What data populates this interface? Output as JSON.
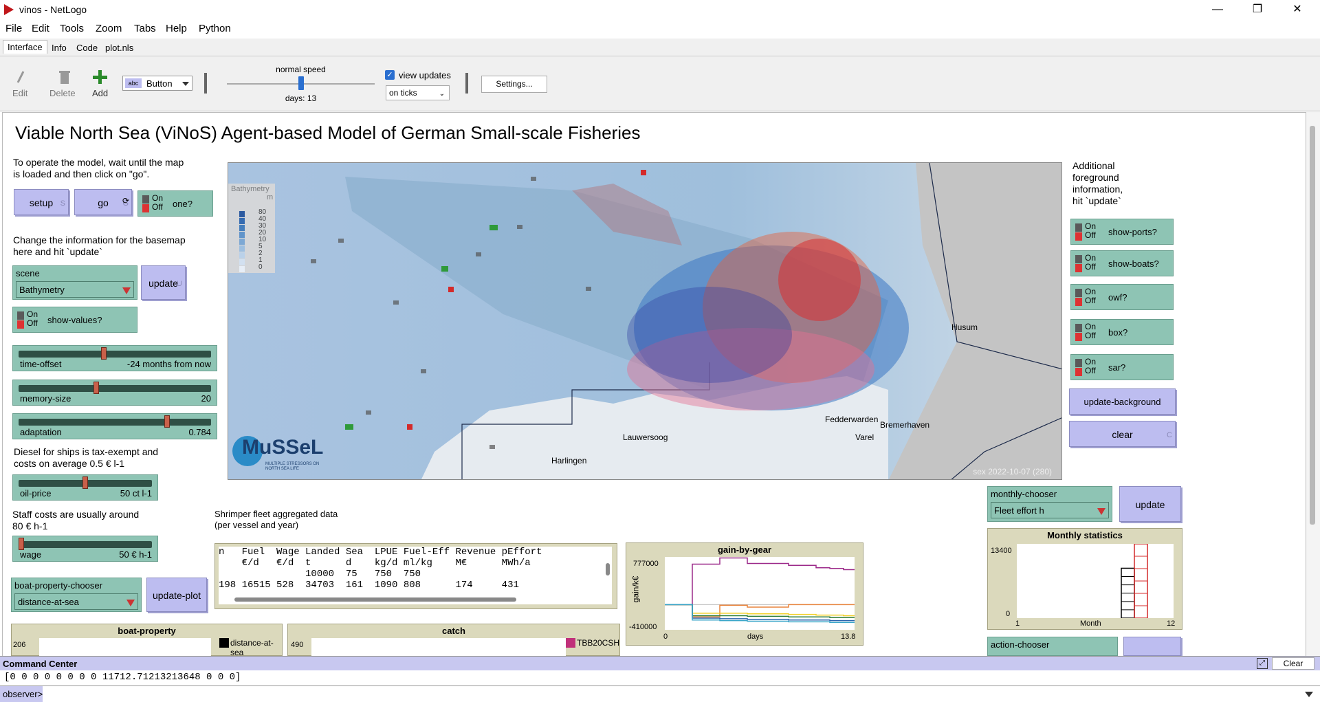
{
  "window": {
    "title": "vinos - NetLogo",
    "min_glyph": "—",
    "max_glyph": "❐",
    "close_glyph": "✕"
  },
  "menu": [
    "File",
    "Edit",
    "Tools",
    "Zoom",
    "Tabs",
    "Help",
    "Python"
  ],
  "tabs": [
    "Interface",
    "Info",
    "Code",
    "plot.nls"
  ],
  "toolbar": {
    "edit": "Edit",
    "delete": "Delete",
    "add": "Add",
    "widget_type": "Button",
    "speed_label": "normal speed",
    "ticks_label": "days: 13",
    "speed_fraction": 0.5,
    "view_updates": "view updates",
    "update_mode": "on ticks",
    "settings": "Settings..."
  },
  "model": {
    "title": "Viable North Sea (ViNoS) Agent-based Model of German Small-scale Fisheries",
    "intro": [
      "To operate the model, wait until the map",
      "is loaded and then click on \"go\"."
    ],
    "basemap_note": [
      "Change the information for the basemap",
      "here and hit `update`"
    ],
    "diesel_note": [
      "Diesel for ships is tax-exempt and",
      "costs on average 0.5 € l-1"
    ],
    "staff_note": [
      "Staff costs are usually around",
      "80 € h-1"
    ],
    "foreground_note": [
      "Additional",
      "foreground",
      "information,",
      "hit `update`"
    ],
    "fleet_note": [
      "Shrimper fleet aggregated data",
      "(per vessel and year)"
    ]
  },
  "buttons": {
    "setup": "setup",
    "setup_key": "S",
    "go": "go",
    "go_key": "G",
    "update_scene": "update",
    "update_scene_key": "U",
    "update_plot": "update-plot",
    "update_background": "update-background",
    "clear": "clear",
    "clear_key": "C",
    "update_monthly": "update"
  },
  "switches": {
    "on": "On",
    "off": "Off",
    "one": "one?",
    "show_values": "show-values?",
    "show_ports": "show-ports?",
    "show_boats": "show-boats?",
    "owf": "owf?",
    "box": "box?",
    "sar": "sar?"
  },
  "sliders": [
    {
      "label": "time-offset",
      "value": "-24 months from now",
      "fraction": 0.44
    },
    {
      "label": "memory-size",
      "value": "20",
      "fraction": 0.4
    },
    {
      "label": "adaptation",
      "value": "0.784",
      "fraction": 0.78
    },
    {
      "label": "oil-price",
      "value": "50 ct l-1",
      "fraction": 0.5
    },
    {
      "label": "wage",
      "value": "50 € h-1",
      "fraction": 0.0
    }
  ],
  "choosers": {
    "scene": {
      "label": "scene",
      "value": "Bathymetry"
    },
    "boat_property": {
      "label": "boat-property-chooser",
      "value": "distance-at-sea"
    },
    "monthly": {
      "label": "monthly-chooser",
      "value": "Fleet effort h"
    },
    "action": {
      "label": "action-chooser"
    }
  },
  "map": {
    "legend_title": "Bathymetry",
    "legend_unit": "m",
    "legend_values": [
      "80",
      "40",
      "30",
      "20",
      "10",
      "5",
      "2",
      "1",
      "0"
    ],
    "legend_colors": [
      "#1f4f9a",
      "#2a63ad",
      "#3c78ba",
      "#5a8fc8",
      "#79a6d3",
      "#9dbfe0",
      "#bcd3eb",
      "#d7e4f2",
      "#eef3fa"
    ],
    "places": [
      "Lauwersoog",
      "Harlingen",
      "Varel",
      "Husum",
      "Fedderwarden",
      "Bremerhaven"
    ],
    "logo_text": "MuSSeL",
    "logo_sub": "MULTIPLE STRESSORS ON NORTH SEA LIFE",
    "timestamp": "sex 2022-10-07 (280)"
  },
  "fleet_table": {
    "headers": [
      [
        "n",
        "Fuel",
        "Wage",
        "Landed",
        "Sea",
        "LPUE",
        "Fuel-Eff",
        "Revenue",
        "pEffort"
      ],
      [
        "",
        "€/d",
        "€/d",
        "t",
        "d",
        "kg/d",
        "ml/kg",
        "M€",
        "MWh/a"
      ],
      [
        "",
        "",
        "",
        "10000",
        "75",
        "750",
        "750",
        "",
        ""
      ]
    ],
    "row": [
      "198",
      "16515",
      "528",
      "34703",
      "161",
      "1090",
      "808",
      "174",
      "431"
    ]
  },
  "plots": {
    "gain_by_gear": {
      "title": "gain-by-gear",
      "ylabel": "gain/k€",
      "xlabel": "days",
      "ymax": "777000",
      "ymin": "-410000",
      "xmin": "0",
      "xmax": "13.8"
    },
    "monthly": {
      "title": "Monthly statistics",
      "ymax": "13400",
      "ymin": "0",
      "xmin": "1",
      "xlabel": "Month",
      "xmax": "12"
    },
    "boat_property": {
      "title": "boat-property",
      "ymax": "206",
      "legend": "distance-at-sea"
    },
    "catch": {
      "title": "catch",
      "ymax": "490",
      "legend": "TBB20CSH"
    }
  },
  "chart_data": [
    {
      "type": "line",
      "title": "gain-by-gear",
      "xlabel": "days",
      "ylabel": "gain/k€",
      "xlim": [
        0,
        13.8
      ],
      "ylim": [
        -410000,
        777000
      ],
      "x": [
        0,
        1,
        2,
        3,
        4,
        5,
        6,
        7,
        8,
        9,
        10,
        11,
        12,
        13,
        13.8
      ],
      "series": [
        {
          "color": "#9c2a8a",
          "values": [
            0,
            0,
            660000,
            660000,
            760000,
            760000,
            670000,
            670000,
            670000,
            640000,
            640000,
            600000,
            590000,
            570000,
            570000
          ]
        },
        {
          "color": "#e8843c",
          "values": [
            0,
            0,
            -200000,
            -200000,
            -10000,
            -10000,
            -40000,
            -40000,
            -40000,
            0,
            0,
            0,
            0,
            0,
            0
          ]
        },
        {
          "color": "#f2d027",
          "values": [
            0,
            0,
            -140000,
            -140000,
            -140000,
            -140000,
            -150000,
            -150000,
            -150000,
            -160000,
            -160000,
            -170000,
            -170000,
            -180000,
            -180000
          ]
        },
        {
          "color": "#2f7d3a",
          "values": [
            0,
            0,
            -180000,
            -180000,
            -180000,
            -180000,
            -190000,
            -190000,
            -190000,
            -200000,
            -200000,
            -200000,
            -210000,
            -210000,
            -210000
          ]
        },
        {
          "color": "#2a63ad",
          "values": [
            0,
            0,
            -220000,
            -220000,
            -230000,
            -230000,
            -240000,
            -240000,
            -240000,
            -250000,
            -250000,
            -250000,
            -260000,
            -260000,
            -260000
          ]
        },
        {
          "color": "#3aa6c9",
          "values": [
            0,
            0,
            -250000,
            -250000,
            -260000,
            -260000,
            -270000,
            -270000,
            -270000,
            -280000,
            -280000,
            -280000,
            -290000,
            -290000,
            -290000
          ]
        }
      ]
    },
    {
      "type": "bar",
      "title": "Monthly statistics",
      "xlabel": "Month",
      "xlim": [
        1,
        12
      ],
      "ylim": [
        0,
        13400
      ],
      "categories": [
        "9",
        "10"
      ],
      "series": [
        {
          "color": "#000000",
          "values": [
            9000,
            0
          ]
        },
        {
          "color": "#d42a2a",
          "values": [
            0,
            13400
          ]
        }
      ]
    }
  ],
  "command_center": {
    "title": "Command Center",
    "clear": "Clear",
    "output": "[0 0 0 0 0 0 0 0 11712.71213213648 0 0 0]",
    "prompt": "observer>"
  }
}
